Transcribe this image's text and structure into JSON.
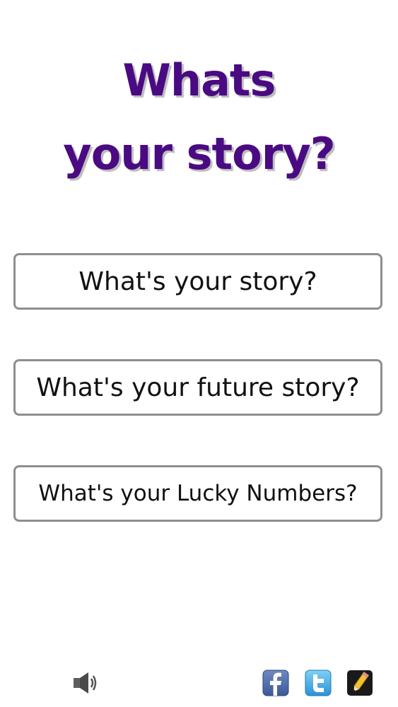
{
  "header": {
    "title_line1": "Whats",
    "title_line2": "your story?"
  },
  "menu": {
    "story_label": "What's your story?",
    "future_label": "What's your future story?",
    "lucky_label": "What's your Lucky Numbers?"
  },
  "footer": {
    "icons": [
      "speaker-icon",
      "facebook-icon",
      "twitter-icon",
      "pencil-icon"
    ]
  },
  "colors": {
    "title": "#4a0a82",
    "button_border": "#8e8e8e",
    "facebook": "#3b5998",
    "twitter": "#3aa1e0"
  }
}
